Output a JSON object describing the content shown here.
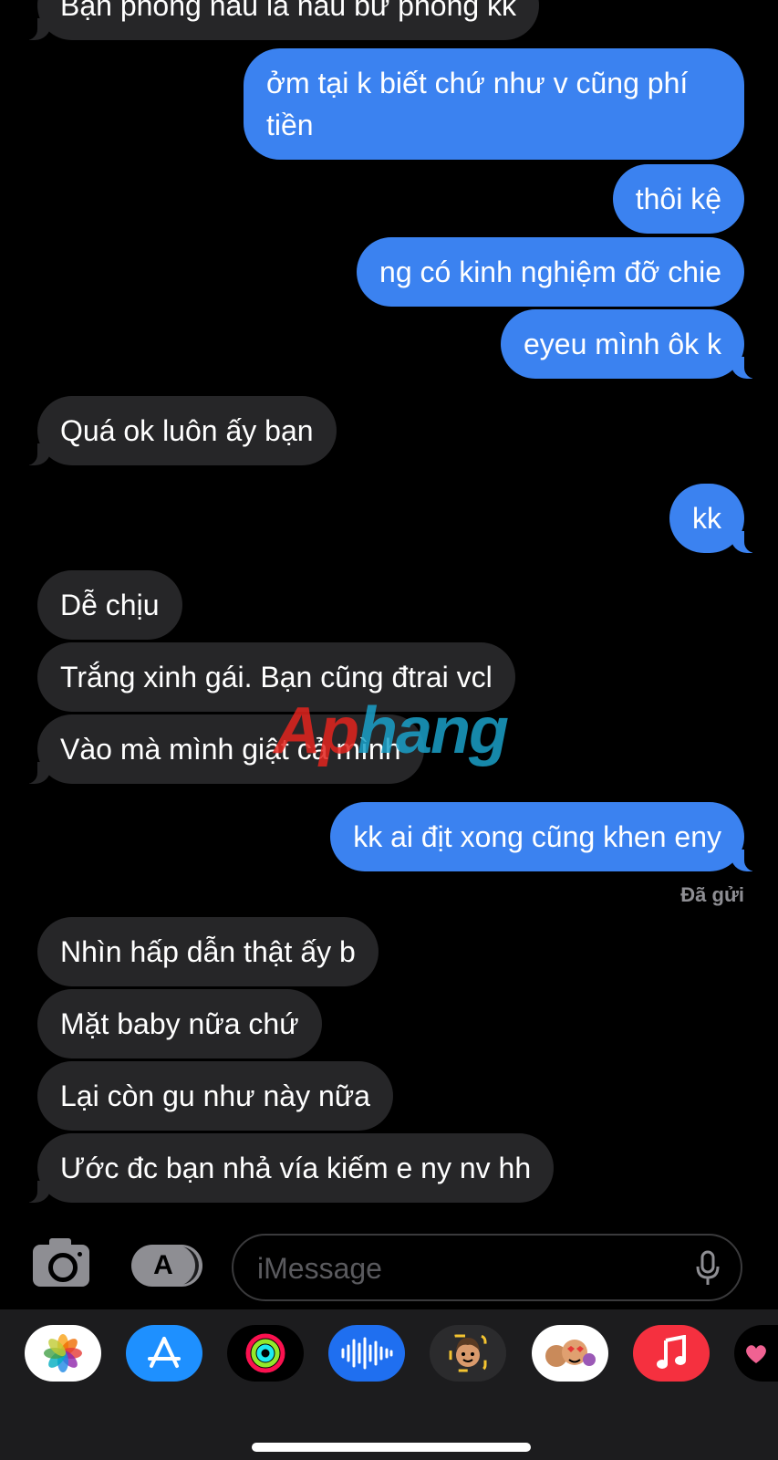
{
  "messages": [
    {
      "dir": "in",
      "text": "Bạn phòng nấu là nấu bữ phòng kk"
    },
    {
      "dir": "out",
      "text": "ởm tại k biết chứ như v cũng phí tiền"
    },
    {
      "dir": "out",
      "text": "thôi kệ"
    },
    {
      "dir": "out",
      "text": "ng có kinh nghiệm đỡ chie"
    },
    {
      "dir": "out",
      "text": "eyeu mình ôk k"
    },
    {
      "dir": "in",
      "text": "Quá ok luôn ấy bạn"
    },
    {
      "dir": "out",
      "text": "kk"
    },
    {
      "dir": "in",
      "text": "Dễ chịu"
    },
    {
      "dir": "in",
      "text": "Trắng xinh gái. Bạn cũng đtrai vcl"
    },
    {
      "dir": "in",
      "text": "Vào mà mình giật cả mình"
    },
    {
      "dir": "out",
      "text": "kk ai địt xong cũng khen eny"
    },
    {
      "dir": "in",
      "text": "Nhìn hấp dẫn thật ấy b"
    },
    {
      "dir": "in",
      "text": "Mặt baby nữa chứ"
    },
    {
      "dir": "in",
      "text": "Lại còn gu như này nữa"
    },
    {
      "dir": "in",
      "text": "Ước đc bạn nhả vía kiếm e ny nv hh"
    }
  ],
  "delivery_status": "Đã gửi",
  "watermark": {
    "part1": "Ap",
    "part2": "hang"
  },
  "composer": {
    "placeholder": "iMessage"
  },
  "app_drawer": [
    "photos-icon",
    "app-store-icon",
    "activity-icon",
    "audio-message-icon",
    "memoji-icon",
    "animoji-stickers-icon",
    "music-icon",
    "more-apps-icon"
  ],
  "colors": {
    "outgoing": "#3b82f0",
    "incoming": "#262628",
    "background": "#000000",
    "drawer": "#1c1c1e"
  }
}
